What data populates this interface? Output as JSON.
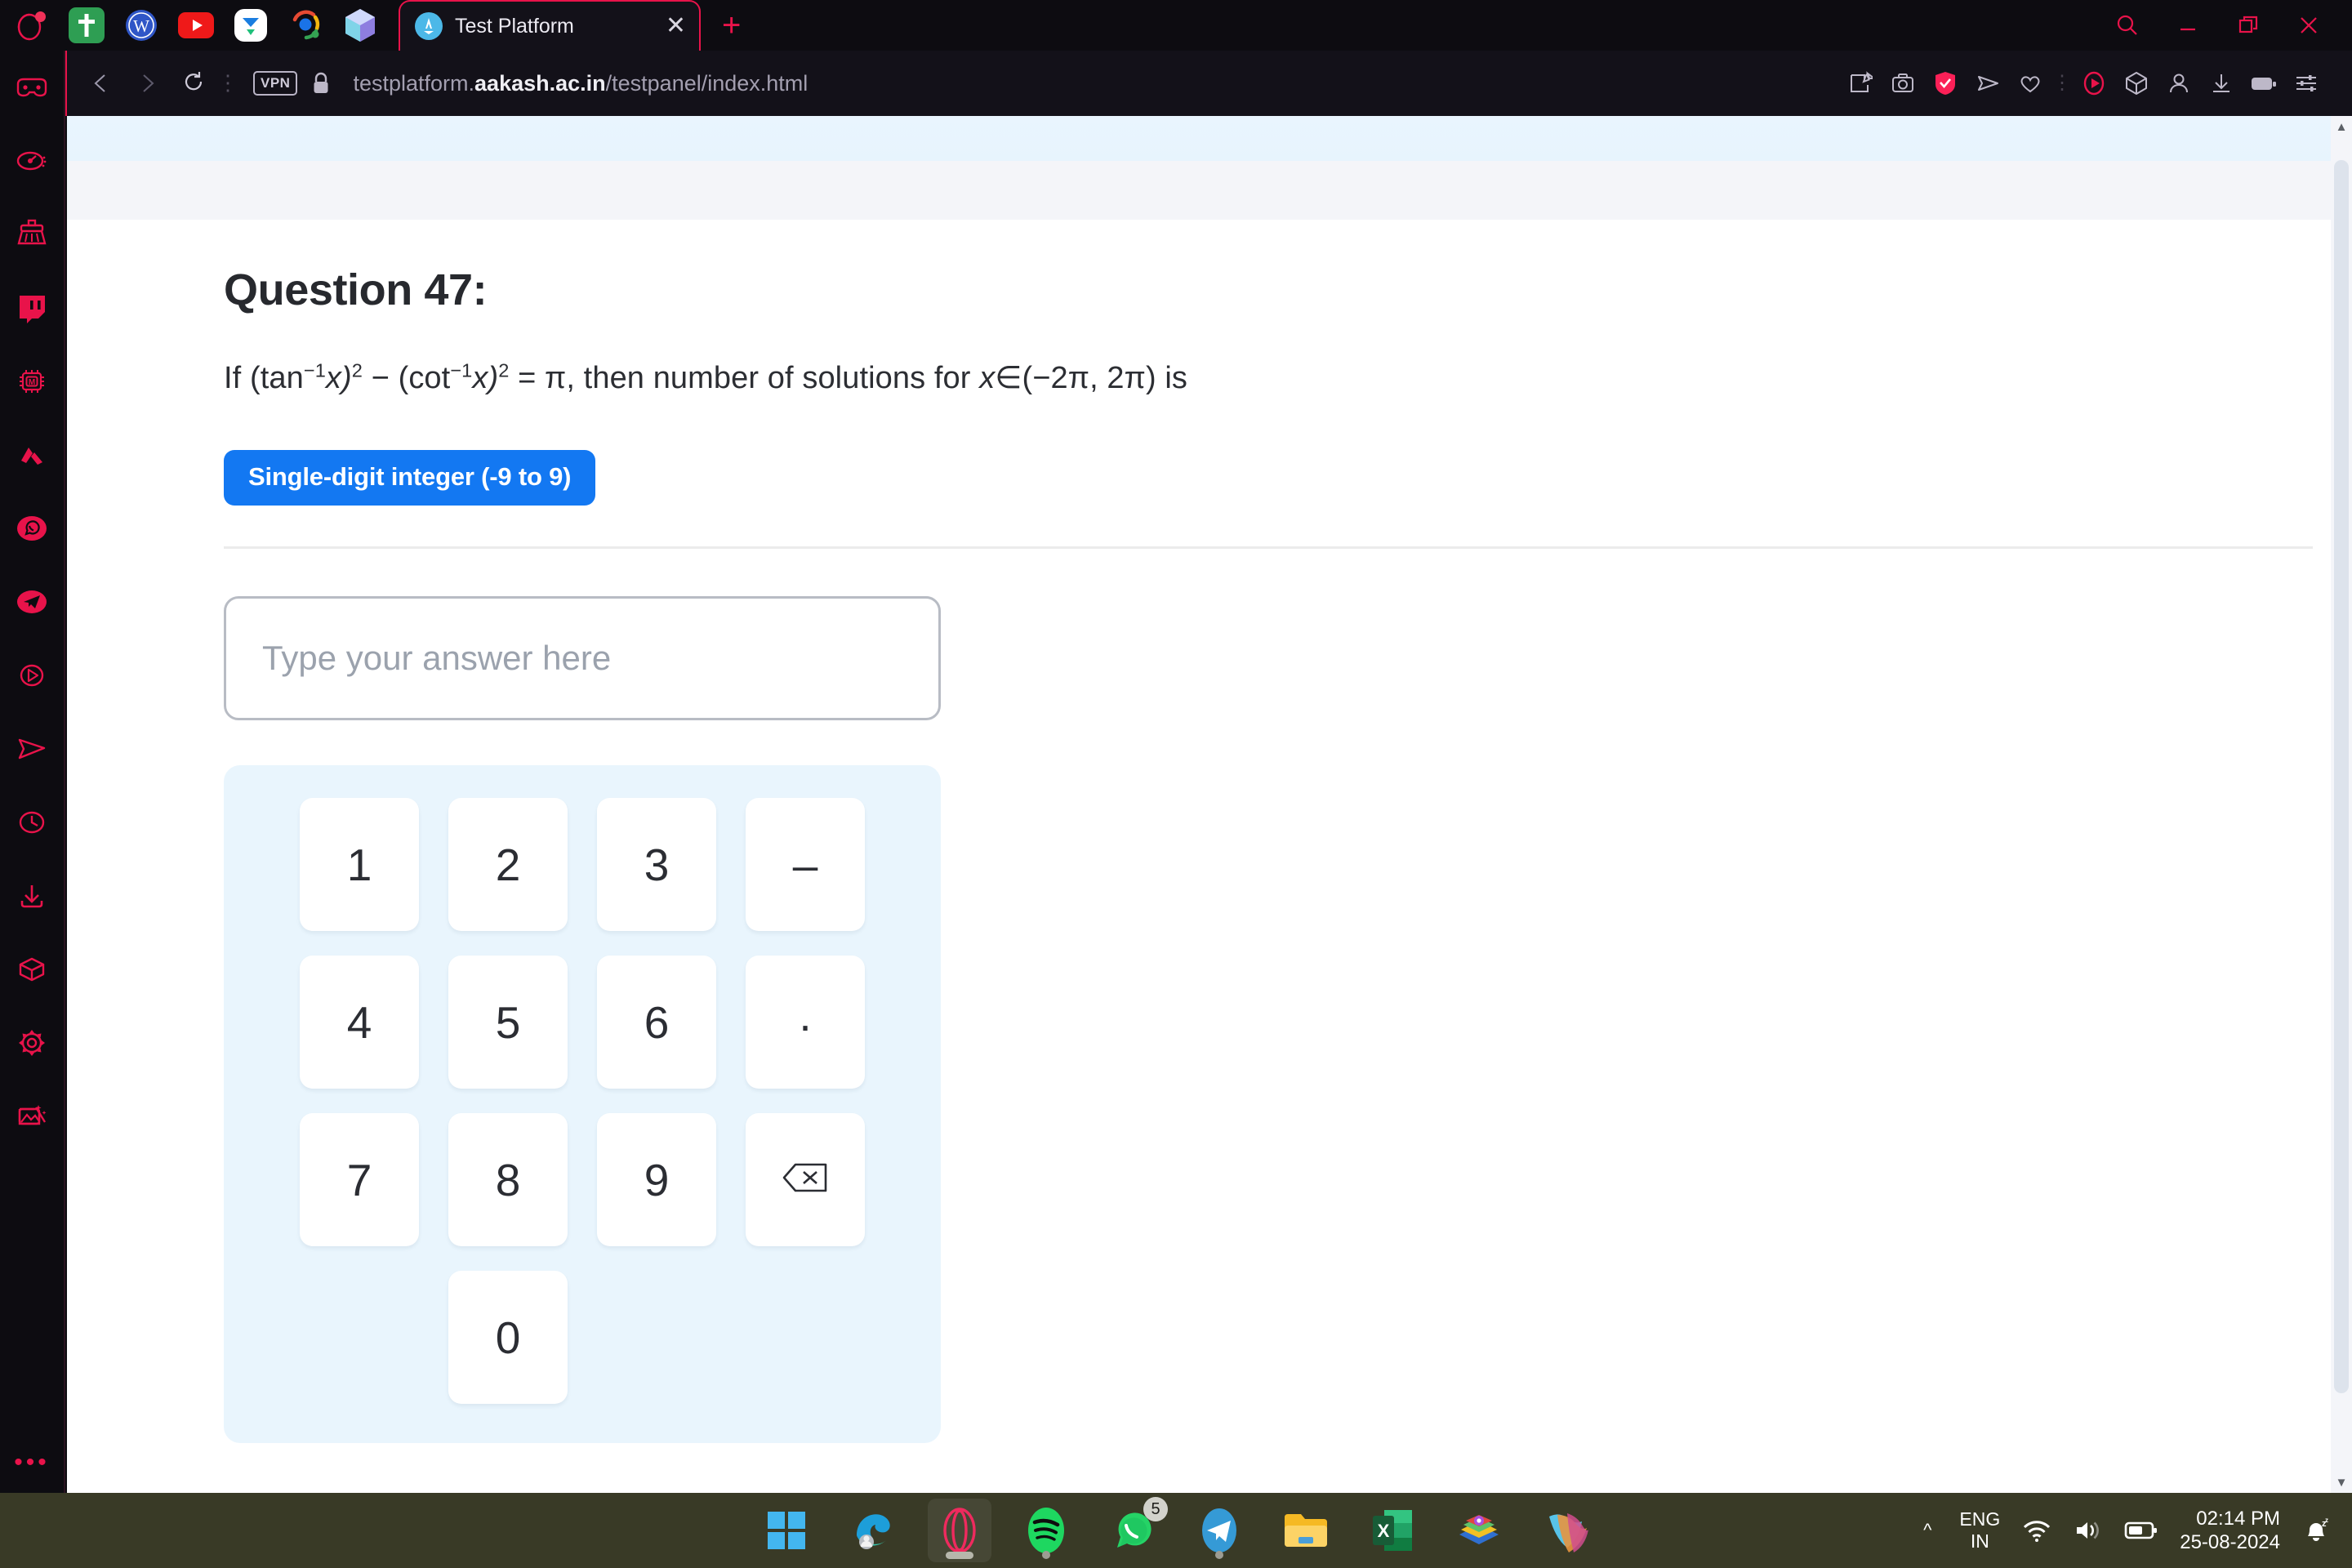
{
  "browser": {
    "name": "Opera GX",
    "logo_icon": "opera-gx-logo",
    "pinned_tabs": [
      {
        "name": "bible-icon",
        "label": "Bible"
      },
      {
        "name": "wordpress-icon",
        "label": "WordPress"
      },
      {
        "name": "youtube-icon",
        "label": "YouTube"
      },
      {
        "name": "messenger-icon",
        "label": "Messenger"
      },
      {
        "name": "google-lens-icon",
        "label": "Google Lens"
      },
      {
        "name": "crypto-wallet-icon",
        "label": "Wallet"
      }
    ],
    "active_tab": {
      "title": "Test Platform",
      "favicon": "aakash-icon",
      "close_icon": "close-icon"
    },
    "new_tab_icon": "plus-icon",
    "window_controls": [
      {
        "name": "search-window-icon",
        "label": "Search"
      },
      {
        "name": "minimize-icon",
        "label": "Minimize"
      },
      {
        "name": "restore-icon",
        "label": "Restore"
      },
      {
        "name": "close-window-icon",
        "label": "Close"
      }
    ],
    "address_bar": {
      "back_icon": "back-icon",
      "forward_icon": "forward-icon",
      "reload_icon": "reload-icon",
      "menu_dots_icon": "vertical-dots-icon",
      "vpn_label": "VPN",
      "lock_icon": "lock-icon",
      "url_prefix": "testplatform.",
      "url_domain": "aakash.ac.in",
      "url_suffix": "/testpanel/index.html",
      "url_full": "testplatform.aakash.ac.in/testpanel/index.html"
    },
    "toolbar_icons": [
      {
        "name": "snapshot-edit-icon",
        "label": "Snapshot edit"
      },
      {
        "name": "camera-icon",
        "label": "Snapshot"
      },
      {
        "name": "shield-check-icon",
        "label": "Ad blocker"
      },
      {
        "name": "send-icon",
        "label": "Flow"
      },
      {
        "name": "heart-icon",
        "label": "Favorites"
      },
      {
        "name": "player-icon",
        "label": "Player"
      },
      {
        "name": "cube-icon",
        "label": "Extensions"
      },
      {
        "name": "profile-icon",
        "label": "Profile"
      },
      {
        "name": "download-icon",
        "label": "Downloads"
      },
      {
        "name": "battery-saver-icon",
        "label": "Battery saver"
      },
      {
        "name": "easy-setup-icon",
        "label": "Easy setup"
      }
    ],
    "sidebar_icons": [
      {
        "name": "gx-corner-icon",
        "label": "GX Corner"
      },
      {
        "name": "gx-control-icon",
        "label": "GX Control"
      },
      {
        "name": "gx-cleaner-icon",
        "label": "GX Cleaner"
      },
      {
        "name": "twitch-icon",
        "label": "Twitch"
      },
      {
        "name": "gx-mods-icon",
        "label": "GX Mods"
      },
      {
        "name": "aria-ai-icon",
        "label": "Aria AI"
      },
      {
        "name": "whatsapp-icon",
        "label": "WhatsApp"
      },
      {
        "name": "telegram-icon",
        "label": "Telegram"
      },
      {
        "name": "player-sidebar-icon",
        "label": "Player"
      },
      {
        "name": "messenger-sidebar-icon",
        "label": "Messengers"
      },
      {
        "name": "history-icon",
        "label": "History"
      },
      {
        "name": "downloads-icon",
        "label": "Downloads"
      },
      {
        "name": "workspaces-icon",
        "label": "Workspaces"
      },
      {
        "name": "settings-icon",
        "label": "Settings"
      },
      {
        "name": "image-tools-icon",
        "label": "Image tools"
      },
      {
        "name": "more-dots-icon",
        "label": "More"
      }
    ]
  },
  "question": {
    "title": "Question 47:",
    "statement_prefix": "If (tan",
    "statement": "If (tan−1x)² − (cot−1x)² = π, then number of solutions for x∈(−2π, 2π) is",
    "parts": {
      "p1": "If (tan",
      "sup1": "−1",
      "p2": "x)",
      "sup2": "2",
      "p3": " − (cot",
      "sup3": "−1",
      "p4": "x)",
      "sup4": "2",
      "p5": " = π, then number of solutions for ",
      "p6": "x",
      "p7": "∈(−2π, 2π) is"
    },
    "type_badge": "Single-digit integer (-9 to 9)",
    "type_badge_color": "#1378f2"
  },
  "answer": {
    "value": "",
    "placeholder": "Type your answer here"
  },
  "keypad": {
    "background_color": "#e9f5fd",
    "rows": [
      [
        {
          "key": "1",
          "name": "keypad-key-1"
        },
        {
          "key": "2",
          "name": "keypad-key-2"
        },
        {
          "key": "3",
          "name": "keypad-key-3"
        },
        {
          "key": "-",
          "name": "keypad-key-minus"
        }
      ],
      [
        {
          "key": "4",
          "name": "keypad-key-4"
        },
        {
          "key": "5",
          "name": "keypad-key-5"
        },
        {
          "key": "6",
          "name": "keypad-key-6"
        },
        {
          "key": ".",
          "name": "keypad-key-dot"
        }
      ],
      [
        {
          "key": "7",
          "name": "keypad-key-7"
        },
        {
          "key": "8",
          "name": "keypad-key-8"
        },
        {
          "key": "9",
          "name": "keypad-key-9"
        },
        {
          "key": "backspace",
          "name": "keypad-key-backspace"
        }
      ],
      [
        {
          "key": "0",
          "name": "keypad-key-0"
        }
      ]
    ],
    "k1": "1",
    "k2": "2",
    "k3": "3",
    "kminus": "–",
    "k4": "4",
    "k5": "5",
    "k6": "6",
    "kdot": ".",
    "k7": "7",
    "k8": "8",
    "k9": "9",
    "k0": "0"
  },
  "scrollbar": {
    "up_icon": "chevron-up-icon",
    "down_icon": "chevron-down-icon"
  },
  "taskbar": {
    "apps": [
      {
        "name": "start-button",
        "label": "Start"
      },
      {
        "name": "edge-icon",
        "label": "Microsoft Edge"
      },
      {
        "name": "opera-gx-taskbar-icon",
        "label": "Opera GX"
      },
      {
        "name": "spotify-icon",
        "label": "Spotify"
      },
      {
        "name": "whatsapp-taskbar-icon",
        "label": "WhatsApp",
        "badge": "5"
      },
      {
        "name": "telegram-taskbar-icon",
        "label": "Telegram"
      },
      {
        "name": "file-explorer-icon",
        "label": "File Explorer"
      },
      {
        "name": "excel-icon",
        "label": "Excel"
      },
      {
        "name": "photos-icon",
        "label": "Photos"
      },
      {
        "name": "copilot-icon",
        "label": "Copilot"
      }
    ],
    "whatsapp_badge": "5",
    "tray": {
      "chevron_icon": "tray-expand-icon",
      "language_line1": "ENG",
      "language_line2": "IN",
      "wifi_icon": "wifi-icon",
      "volume_icon": "volume-icon",
      "battery_icon": "battery-icon",
      "time": "02:14 PM",
      "date": "25-08-2024",
      "notification_icon": "notifications-muted-icon"
    }
  }
}
